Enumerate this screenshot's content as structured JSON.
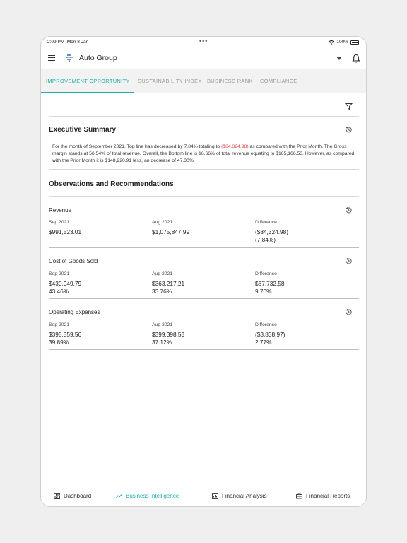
{
  "status": {
    "time": "2:09 PM",
    "date": "Mon 8 Jan",
    "dots": "•••",
    "battery": "100%"
  },
  "appbar": {
    "title": "Auto Group"
  },
  "tabs": [
    {
      "label": "IMPROVEMENT OPPORTUNITY"
    },
    {
      "label": "SUSTAINABILITY INDEX"
    },
    {
      "label": "BUSINESS RANK"
    },
    {
      "label": "COMPLIANCE"
    }
  ],
  "summary": {
    "title": "Executive Summary",
    "text_before": "For the month of September 2021, Top line has decreased by 7.84% totaling to ",
    "text_highlight": "($84,324.98)",
    "text_after": " as compared with the Prior Month. The Gross margin stands at 56.54% of total revenue. Overall, the Bottom line is 16.66% of total revenue equating to $165,166.53. However, as compared with the Prior Month it is $148,220.91 less, an decrease of 47.30%."
  },
  "observations": {
    "title": "Observations and Recommendations",
    "col_labels": {
      "current": "Sep 2021",
      "prior": "Aug 2021",
      "difference": "Difference"
    },
    "items": [
      {
        "name": "Revenue",
        "current": "$991,523.01",
        "current_pct": "",
        "prior": "$1,075,847.99",
        "prior_pct": "",
        "diff": "($84,324.98)",
        "diff_pct": "(7.84%)",
        "diff_negative": true
      },
      {
        "name": "Cost of Goods Sold",
        "current": "$430,949.79",
        "current_pct": "43.46%",
        "prior": "$363,217.21",
        "prior_pct": "33.76%",
        "diff": "$67,732.58",
        "diff_pct": "9.70%",
        "diff_negative": false
      },
      {
        "name": "Operating Expenses",
        "current": "$395,559.56",
        "current_pct": "39.89%",
        "prior": "$399,398.53",
        "prior_pct": "37.12%",
        "diff": "($3,838.97)",
        "diff_pct": "2.77%",
        "diff_negative": true
      }
    ]
  },
  "bottom_nav": [
    {
      "label": "Dashboard",
      "icon": "dashboard-icon"
    },
    {
      "label": "Business Intelligence",
      "icon": "trend-icon"
    },
    {
      "label": "Financial Analysis",
      "icon": "chart-icon"
    },
    {
      "label": "Financial Reports",
      "icon": "briefcase-icon"
    }
  ],
  "colors": {
    "accent": "#1fb0a7",
    "negative": "#e0464f"
  }
}
